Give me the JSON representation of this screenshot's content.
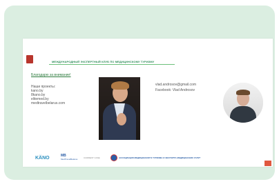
{
  "slide": {
    "club_title": "МЕЖДУНАРОДНЫЙ ЭКСПЕРТНЫЙ КЛУБ ПО МЕДИЦИНСКОМУ ТУРИЗМУ",
    "thanks_text": "Благодарю за внимание!",
    "projects_heading": "Наши проекты:",
    "projects": [
      "kano.by",
      "8kano.by",
      "elitemed.by",
      "medtravelbelarus.com"
    ],
    "contact_email": "vlad.androsov@gmail.com",
    "contact_facebook": "Facebook: Vlad Androsov"
  },
  "footer": {
    "kano_label": "KÄNO",
    "medtravel_mark": "MB",
    "medtravel_label": "MedTravelBelarus",
    "logo3_label": "CURRENT CASE",
    "assoc_label": "АССОЦИАЦИЯ МЕДИЦИНСКОГО ТУРИЗМА И ЭКСПОРТА МЕДИЦИНСКИХ УСЛУГ"
  },
  "colors": {
    "frame_bg": "#dbeee1",
    "accent_green": "#2c8b57",
    "kano_blue": "#2a8fbf"
  }
}
